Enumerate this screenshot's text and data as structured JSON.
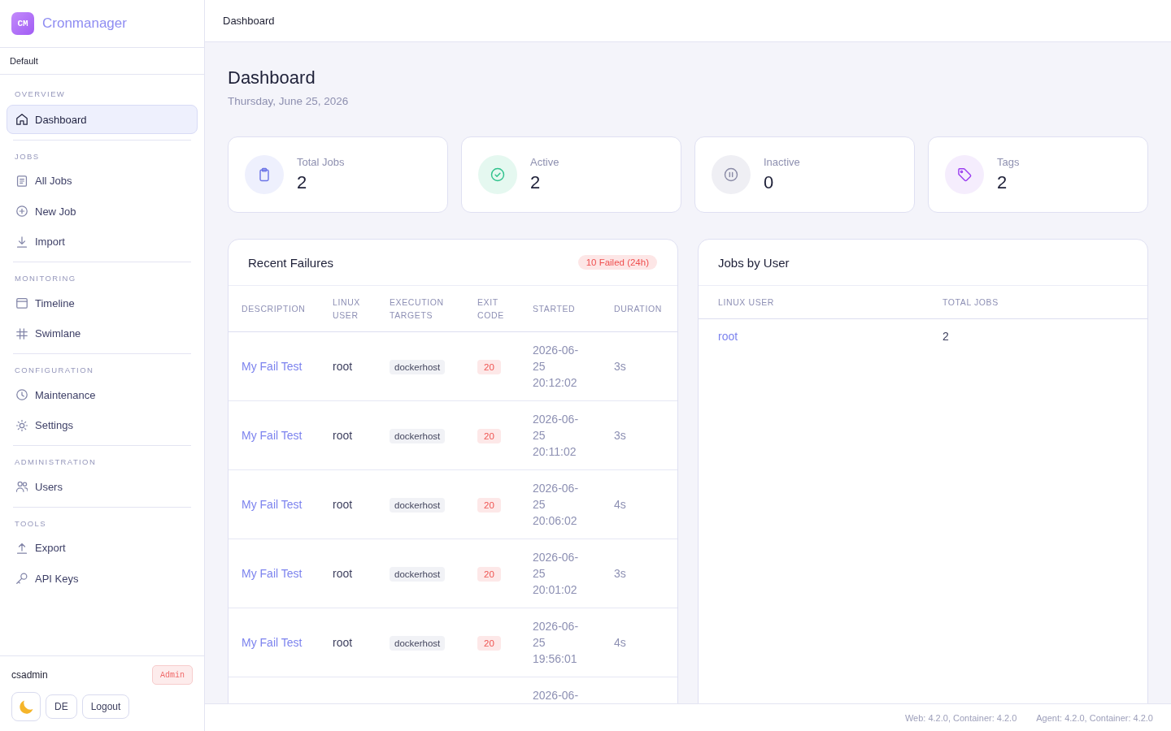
{
  "sidebar": {
    "brand": {
      "logo": "CM",
      "name": "Cronmanager"
    },
    "context": "Default",
    "sections": [
      {
        "label": "OVERVIEW",
        "items": [
          {
            "label": "Dashboard",
            "selected": true
          }
        ]
      },
      {
        "label": "JOBS",
        "items": [
          {
            "label": "All Jobs",
            "selected": false
          },
          {
            "label": "New Job",
            "selected": false
          },
          {
            "label": "Import",
            "selected": false
          }
        ]
      },
      {
        "label": "MONITORING",
        "items": [
          {
            "label": "Timeline",
            "selected": false
          },
          {
            "label": "Swimlane",
            "selected": false
          }
        ]
      },
      {
        "label": "CONFIGURATION",
        "items": [
          {
            "label": "Maintenance",
            "selected": false
          },
          {
            "label": "Settings",
            "selected": false
          }
        ]
      },
      {
        "label": "ADMINISTRATION",
        "items": [
          {
            "label": "Users",
            "selected": false
          }
        ]
      },
      {
        "label": "TOOLS",
        "items": [
          {
            "label": "Export",
            "selected": false
          },
          {
            "label": "API Keys",
            "selected": false
          }
        ]
      }
    ],
    "user": {
      "name": "csadmin",
      "role": "Admin"
    },
    "buttons": [
      "DE",
      "Logout"
    ]
  },
  "header": {
    "title": "Dashboard"
  },
  "page": {
    "title": "Dashboard",
    "date": "Thursday, June 25, 2026"
  },
  "stats": [
    {
      "label": "Total Jobs",
      "value": "2"
    },
    {
      "label": "Active",
      "value": "2"
    },
    {
      "label": "Inactive",
      "value": "0"
    },
    {
      "label": "Tags",
      "value": "2"
    }
  ],
  "recent_failures": {
    "title": "Recent Failures",
    "badge": "10 Failed (24h)",
    "columns": [
      "DESCRIPTION",
      "LINUX USER",
      "EXECUTION TARGETS",
      "EXIT CODE",
      "STARTED",
      "DURATION"
    ],
    "rows": [
      {
        "description": "My Fail Test",
        "linux_user": "root",
        "targets": [
          "dockerhost"
        ],
        "exit_code": "20",
        "started": "2026-06-25 20:12:02",
        "duration": "3s"
      },
      {
        "description": "My Fail Test",
        "linux_user": "root",
        "targets": [
          "dockerhost"
        ],
        "exit_code": "20",
        "started": "2026-06-25 20:11:02",
        "duration": "3s"
      },
      {
        "description": "My Fail Test",
        "linux_user": "root",
        "targets": [
          "dockerhost"
        ],
        "exit_code": "20",
        "started": "2026-06-25 20:06:02",
        "duration": "4s"
      },
      {
        "description": "My Fail Test",
        "linux_user": "root",
        "targets": [
          "dockerhost"
        ],
        "exit_code": "20",
        "started": "2026-06-25 20:01:02",
        "duration": "3s"
      },
      {
        "description": "My Fail Test",
        "linux_user": "root",
        "targets": [
          "dockerhost"
        ],
        "exit_code": "20",
        "started": "2026-06-25 19:56:01",
        "duration": "4s"
      },
      {
        "started": "2026-06-"
      }
    ]
  },
  "jobs_by_user": {
    "title": "Jobs by User",
    "columns": [
      "LINUX USER",
      "TOTAL JOBS"
    ],
    "rows": [
      {
        "user": "root",
        "total_jobs": "2"
      }
    ]
  },
  "footer": {
    "versions": [
      "Web: 4.2.0, Container: 4.2.0",
      "Agent: 4.2.0, Container: 4.2.0"
    ]
  }
}
